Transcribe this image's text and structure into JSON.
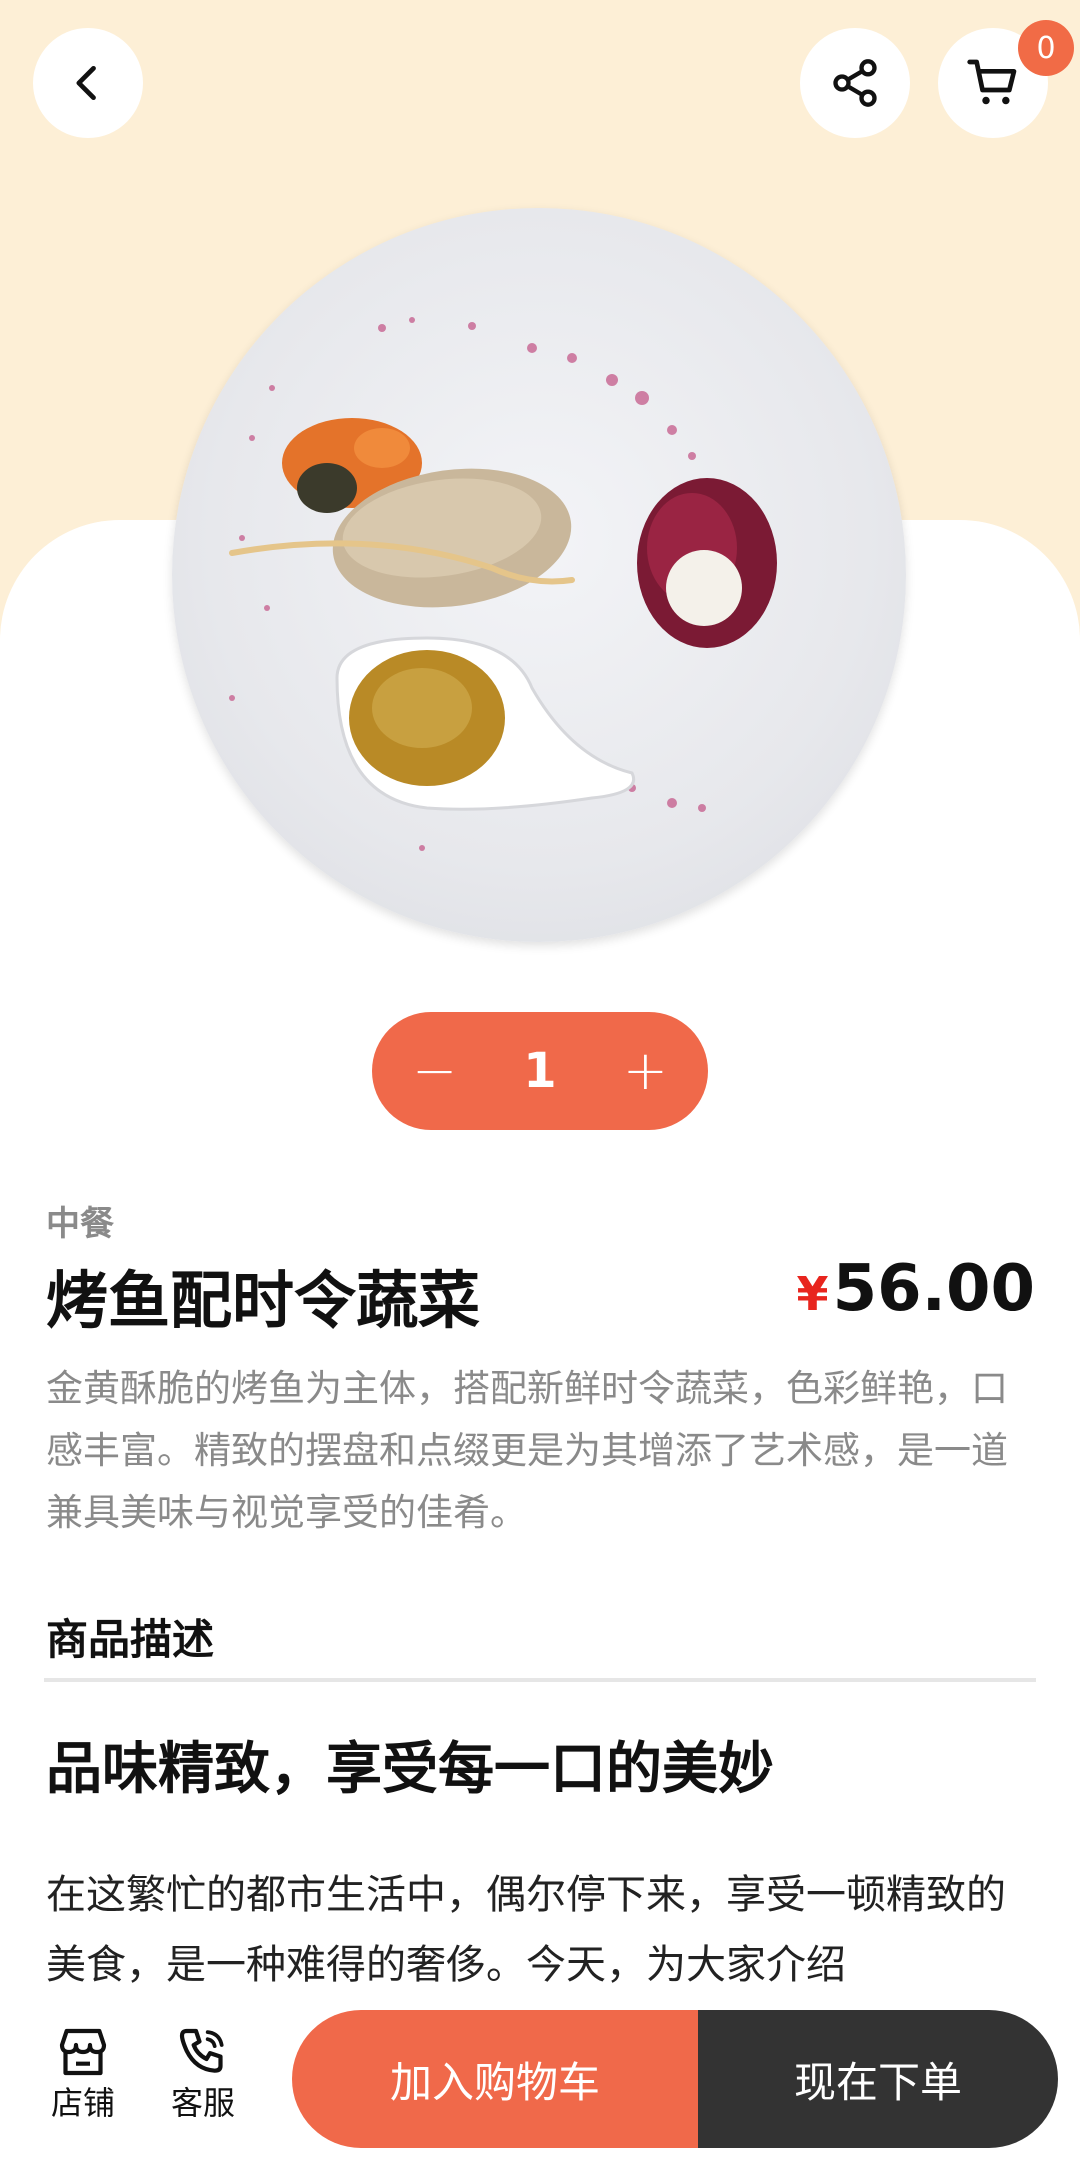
{
  "header": {
    "back_icon": "chevron-left-icon",
    "share_icon": "share-icon",
    "cart_icon": "cart-icon",
    "cart_count": "0"
  },
  "quantity": {
    "minus": "−",
    "value": "1",
    "plus": "+"
  },
  "product": {
    "category": "中餐",
    "title": "烤鱼配时令蔬菜",
    "price_symbol": "¥",
    "price": "56.00",
    "summary": "金黄酥脆的烤鱼为主体，搭配新鲜时令蔬菜，色彩鲜艳，口感丰富。精致的摆盘和点缀更是为其增添了艺术感，是一道兼具美味与视觉享受的佳肴。"
  },
  "details": {
    "section_label": "商品描述",
    "headline": "品味精致，享受每一口的美妙",
    "body": "在这繁忙的都市生活中，偶尔停下来，享受一顿精致的美食，是一种难得的奢侈。今天，为大家介绍"
  },
  "bottom": {
    "store_label": "店铺",
    "service_label": "客服",
    "add_to_cart": "加入购物车",
    "order_now": "现在下单"
  },
  "colors": {
    "accent": "#f0694a",
    "dark": "#333333",
    "hero_bg": "#fdefd6",
    "price_symbol": "#e8251e"
  }
}
